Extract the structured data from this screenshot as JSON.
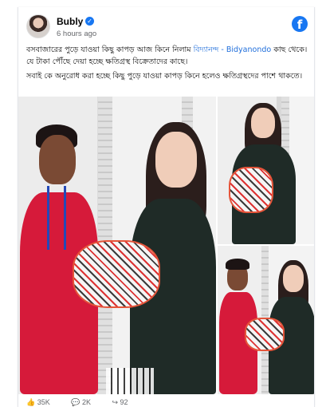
{
  "post": {
    "author": "Bubly",
    "verified_icon": "verified-badge-icon",
    "timestamp": "6 hours ago",
    "caption_line1_pre": "বসবাজারের পুড়ে যাওয়া কিছু কাপড় আজ কিনে নিলাম ",
    "caption_link": "বিদ্যানন্দ - Bidyanondo",
    "caption_line1_post": " কাছ থেকে। যে টাকা পৌঁছে দেয়া হচ্ছে ক্ষতিগ্রস্থ বিক্রেতাদের কাছে।",
    "caption_line2": "সবাই কে অনুরোধ করা হচ্ছে কিছু পুড়ে যাওয়া কাপড় কিনে হলেও ক্ষতিগ্রস্থদের পাশে থাকতে।"
  },
  "brand": {
    "logo_letter": "f",
    "color": "#1877f2"
  },
  "reactions": {
    "likes": "35K",
    "comments": "2K",
    "shares": "92"
  }
}
